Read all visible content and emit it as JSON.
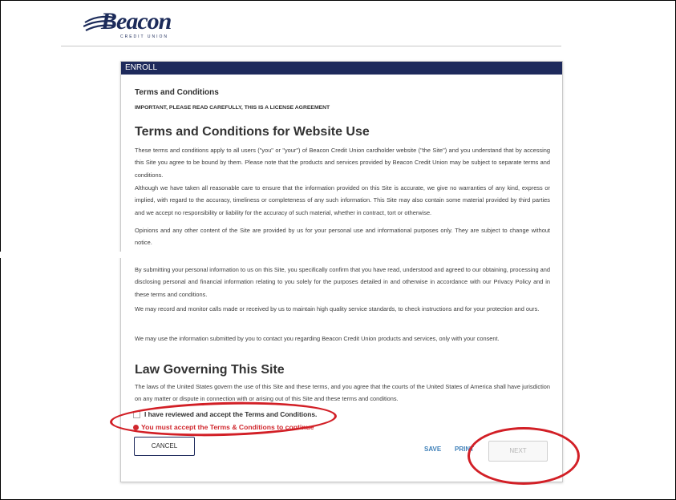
{
  "brand": {
    "name": "Beacon",
    "subtitle": "CREDIT UNION",
    "brand_color": "#1c2b5a"
  },
  "panel": {
    "header": "ENROLL",
    "section_title": "Terms and Conditions",
    "notice": "IMPORTANT, PLEASE READ CAREFULLY, THIS IS A LICENSE AGREEMENT",
    "heading_website_use": "Terms and Conditions for Website Use",
    "paragraphs": [
      "These terms and conditions apply to all users (\"you\" or \"your\") of Beacon Credit Union cardholder website (\"the Site\") and you understand that by accessing this Site you agree to be bound by them. Please note that the products and services provided by Beacon Credit Union may be subject to separate terms and conditions.",
      "Although we have taken all reasonable care to ensure that the information provided on this Site is accurate, we give no warranties of any kind, express or implied, with regard to the accuracy, timeliness or completeness of any such information. This Site may also contain some material provided by third parties and we accept no responsibility or liability for the accuracy of such material, whether in contract, tort or otherwise.",
      "Opinions and any other content of the Site are provided by us for your personal use and informational purposes only. They are subject to change without notice.",
      "By submitting your personal information to us on this Site, you specifically confirm that you have read, understood and agreed to our obtaining, processing and disclosing personal and financial information relating to you solely for the purposes detailed in and otherwise in accordance with our Privacy Policy and in these terms and conditions.",
      "We may record and monitor calls made or received by us to maintain high quality service standards, to check instructions and for your protection and ours.",
      "We may use the information submitted by you to contact you regarding Beacon Credit Union products and services, only with your consent."
    ],
    "heading_law": "Law Governing This Site",
    "law_text": "The laws of the United States govern the use of this Site and these terms, and you agree that the courts of the United States of America shall have jurisdiction on any matter or dispute in connection with or arising out of this Site and these terms and conditions.",
    "accept_label": "I have reviewed and accept the Terms and Conditions.",
    "accept_checked": false,
    "error_text": "You must accept the Terms & Conditions to continue",
    "cancel_label": "CANCEL",
    "save_label": "SAVE",
    "print_label": "PRINT",
    "next_label": "NEXT",
    "colors": {
      "header_bg": "#1e2a5c",
      "link": "#3d7fb8",
      "error": "#d0282e",
      "annotation": "#d21f26"
    }
  }
}
